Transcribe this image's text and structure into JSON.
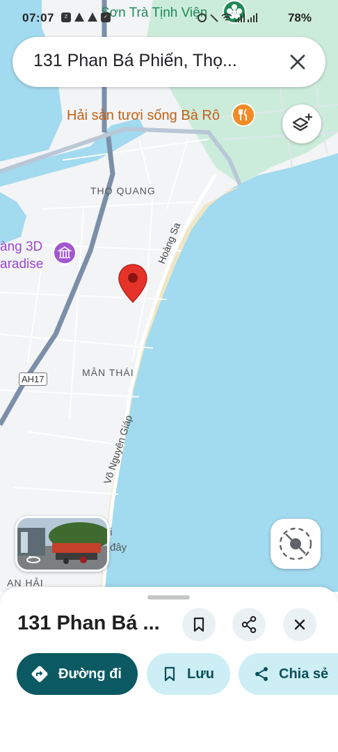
{
  "status_bar": {
    "time": "07:07",
    "battery": "78%",
    "left_icons": [
      "zalo-icon",
      "warning-icon",
      "warning-icon",
      "check-icon"
    ],
    "right_icons": [
      "alarm-icon",
      "mute-icon",
      "wifi-icon",
      "signal-icon",
      "signal-icon"
    ]
  },
  "search": {
    "query": "131 Phan Bá Phiến, Thọ...",
    "close_icon": "close-icon"
  },
  "map_labels": {
    "temple": "Sơn Trà Tịnh Viện",
    "restaurant": "Hải sản tươi sống Bà Rô",
    "district_1": "THỌ QUANG",
    "museum_line1": "àng 3D",
    "museum_line2": "aradise",
    "street_hoang_sa": "Hoàng Sa",
    "district_2": "MÂN THÁI",
    "highway": "AH17",
    "street_vo_nguyen_giap": "Võ Nguyên Giáp",
    "partial_1": "i",
    "partial_2": "đây",
    "district_3": "AN HẢI"
  },
  "place_sheet": {
    "title": "131 Phan Bá ...",
    "actions": {
      "directions": "Đường đi",
      "save": "Lưu",
      "share": "Chia sẻ"
    }
  },
  "colors": {
    "water": "#a2daef",
    "land": "#f3f4f6",
    "park": "#ccecdb",
    "accent": "#0b5963",
    "pin": "#e6332a",
    "restaurant": "#f28b25",
    "museum": "#a256d1"
  }
}
